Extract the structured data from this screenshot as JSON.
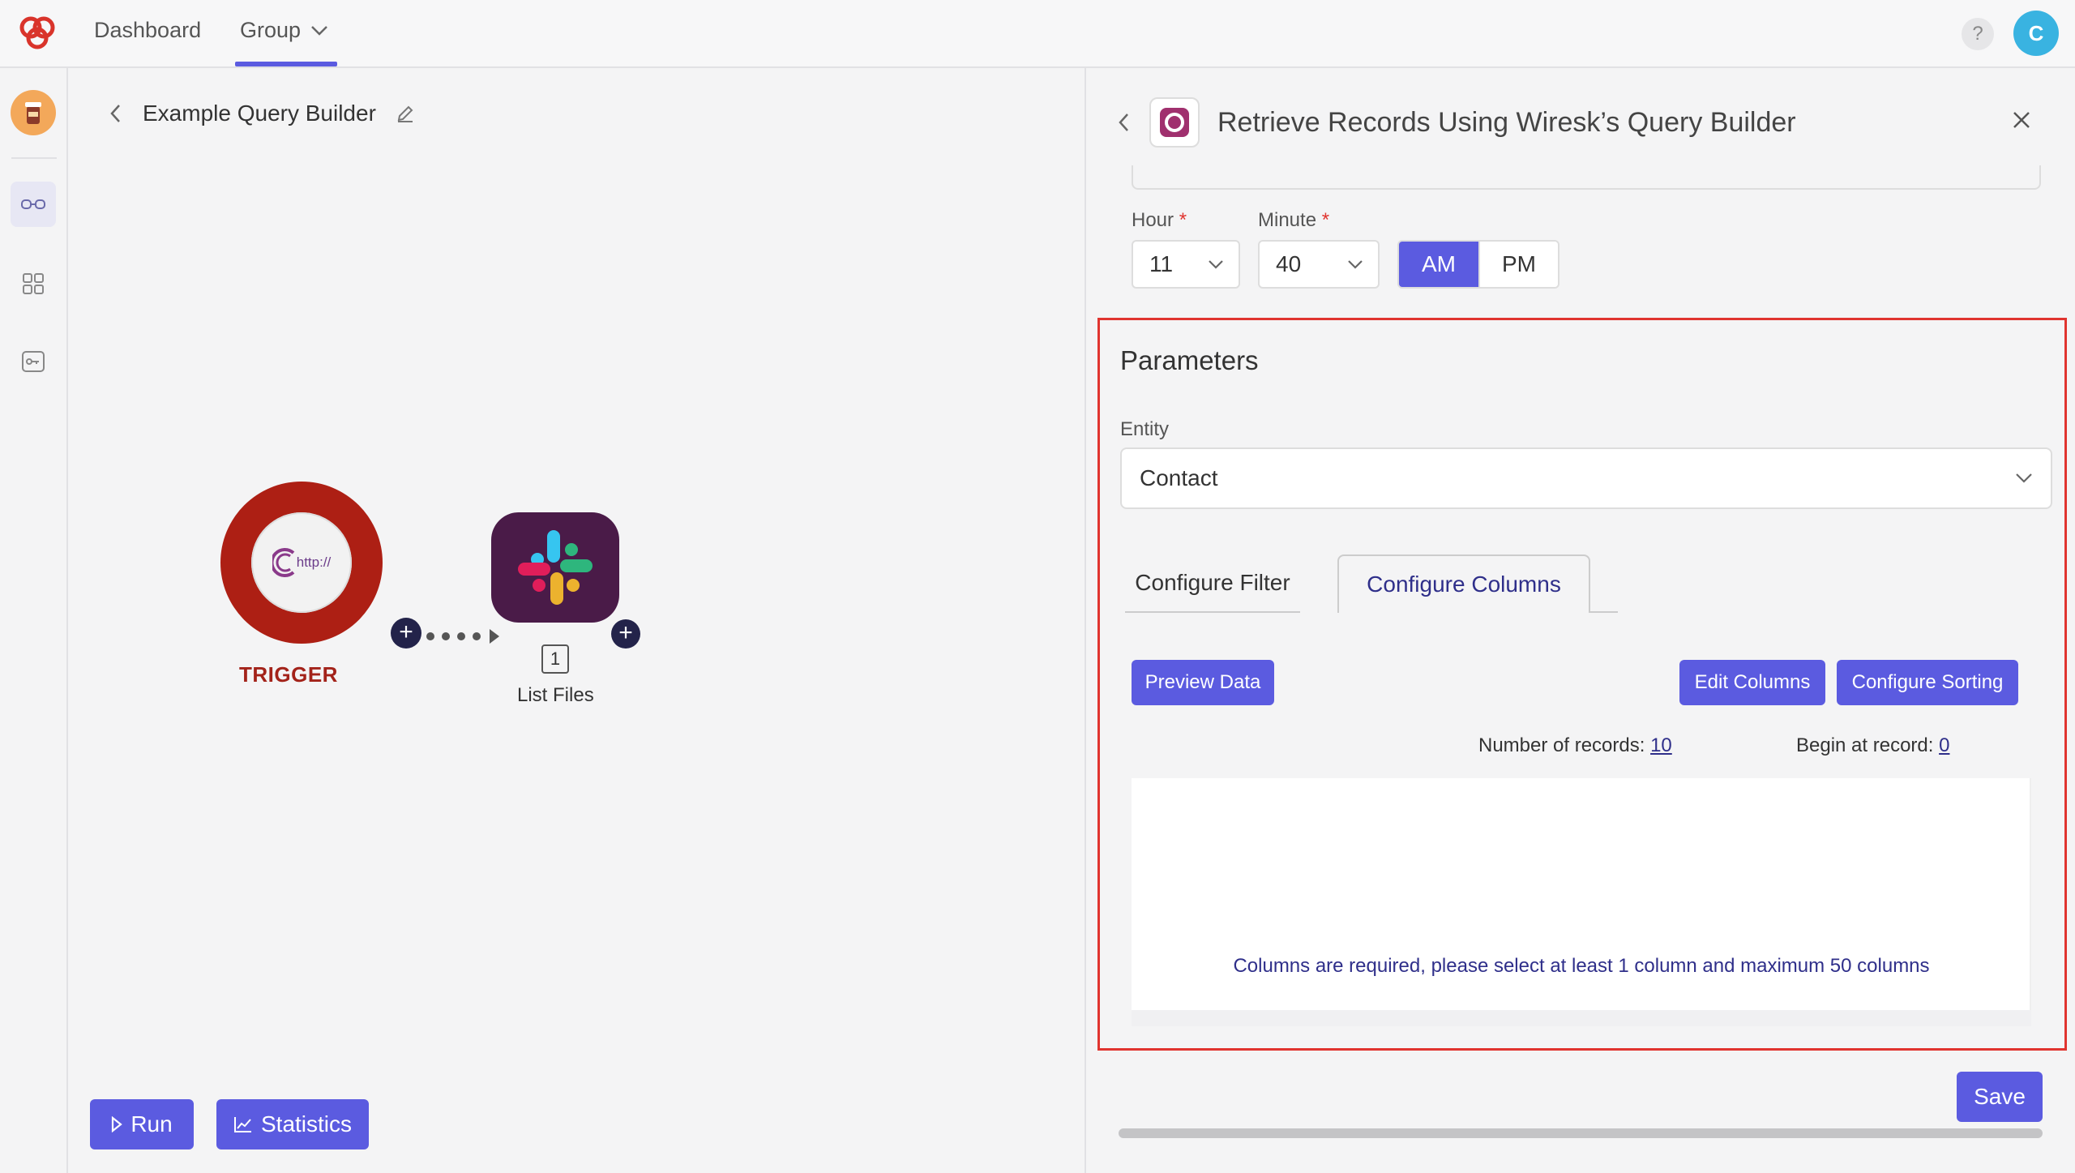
{
  "topbar": {
    "nav": {
      "dashboard": "Dashboard",
      "group": "Group"
    },
    "help": "?",
    "user_initial": "C"
  },
  "canvas": {
    "scenario_title": "Example Query Builder",
    "trigger_text": "http://",
    "trigger_label": "TRIGGER",
    "node_count": "1",
    "node_label": "List Files",
    "run_label": "Run",
    "statistics_label": "Statistics"
  },
  "panel": {
    "title": "Retrieve Records Using Wiresk’s Query Builder",
    "hour": {
      "label": "Hour",
      "required": "*",
      "value": "11"
    },
    "minute": {
      "label": "Minute",
      "required": "*",
      "value": "40"
    },
    "am": "AM",
    "pm": "PM",
    "parameters_title": "Parameters",
    "entity": {
      "label": "Entity",
      "value": "Contact"
    },
    "tabs": {
      "filter": "Configure Filter",
      "columns": "Configure Columns"
    },
    "buttons": {
      "preview": "Preview Data",
      "edit_columns": "Edit Columns",
      "sorting": "Configure Sorting"
    },
    "records": {
      "count_label": "Number of records:",
      "count_value": "10",
      "begin_label": "Begin at record:",
      "begin_value": "0"
    },
    "empty_message": "Columns are required, please select at least 1 column and maximum 50 columns",
    "save_label": "Save"
  },
  "colors": {
    "accent": "#5b5be0",
    "trigger_red": "#ad1f14",
    "highlight": "#e0342f",
    "slack_bg": "#4a1b48"
  }
}
